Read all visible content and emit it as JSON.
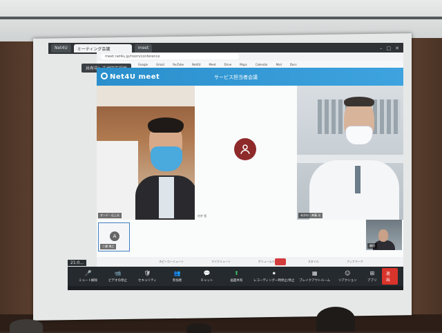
{
  "browser": {
    "active_tab": "ミーティング会議",
    "tabs": [
      "ミーティング会議",
      "Net4U",
      "meet"
    ],
    "url": "meet.net4u.jp/room/conference",
    "bookmarks": [
      "Google",
      "Gmail",
      "YouTube",
      "Net4U",
      "Meet",
      "Drive",
      "Maps",
      "Calendar",
      "Mail",
      "Docs"
    ],
    "status_chip": "共有中：千代田市役所"
  },
  "app": {
    "logo": "Net4U meet",
    "room_title": "サービス担当者会議"
  },
  "participants": {
    "left_label": "ダンデ・石上光",
    "center_label": "村井 智",
    "right_label": "みかの・斉藤 光",
    "thumb_left_initial": "A",
    "thumb_left_label": "二瀬 博之",
    "thumb_right_label": "森田"
  },
  "info_strip": [
    "スピーカーミュート",
    "マイクミュート",
    "ボリュームテスト",
    "スタイル",
    "ブックマーク"
  ],
  "toolbar": {
    "time": "21:0…",
    "controls": [
      {
        "icon": "mic-icon",
        "glyph": "🎤",
        "label": "ミュート解除"
      },
      {
        "icon": "camera-icon",
        "glyph": "📹",
        "label": "ビデオの停止"
      },
      {
        "icon": "security-icon",
        "glyph": "🛡",
        "label": "セキュリティ"
      },
      {
        "icon": "participants-icon",
        "glyph": "👥",
        "label": "参加者"
      },
      {
        "icon": "chat-icon",
        "glyph": "💬",
        "label": "チャット"
      },
      {
        "icon": "share-screen-icon",
        "glyph": "⬆",
        "label": "画面共有",
        "green": true
      },
      {
        "icon": "record-icon",
        "glyph": "⏺",
        "label": "レコーディング一時停止/停止"
      },
      {
        "icon": "breakout-icon",
        "glyph": "▦",
        "label": "ブレイクアウトルーム"
      },
      {
        "icon": "reaction-icon",
        "glyph": "☺",
        "label": "リアクション"
      },
      {
        "icon": "apps-icon",
        "glyph": "⊞",
        "label": "アプリ"
      }
    ],
    "leave_label": "退出"
  }
}
